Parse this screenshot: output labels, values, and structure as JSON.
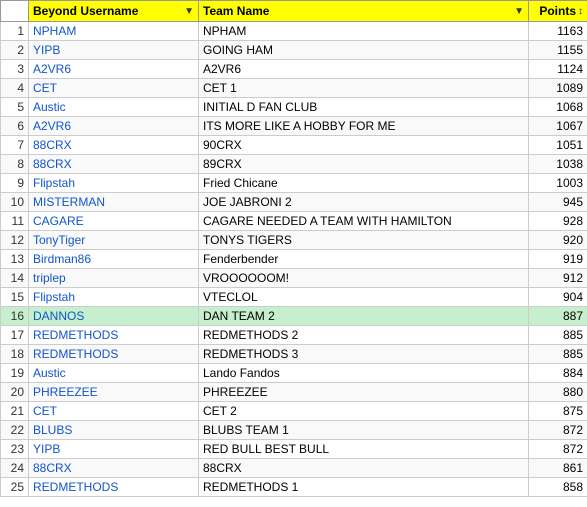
{
  "headers": {
    "num": "",
    "username": "Beyond Username",
    "team": "Team Name",
    "points": "Points"
  },
  "rows": [
    {
      "num": 1,
      "username": "NPHAM",
      "team": "NPHAM",
      "points": 1163
    },
    {
      "num": 2,
      "username": "YIPB",
      "team": "GOING HAM",
      "points": 1155
    },
    {
      "num": 3,
      "username": "A2VR6",
      "team": "A2VR6",
      "points": 1124
    },
    {
      "num": 4,
      "username": "CET",
      "team": "CET 1",
      "points": 1089
    },
    {
      "num": 5,
      "username": "Austic",
      "team": "INITIAL D FAN CLUB",
      "points": 1068
    },
    {
      "num": 6,
      "username": "A2VR6",
      "team": "ITS MORE LIKE A HOBBY FOR ME",
      "points": 1067
    },
    {
      "num": 7,
      "username": "88CRX",
      "team": "90CRX",
      "points": 1051
    },
    {
      "num": 8,
      "username": "88CRX",
      "team": "89CRX",
      "points": 1038
    },
    {
      "num": 9,
      "username": "Flipstah",
      "team": "Fried Chicane",
      "points": 1003
    },
    {
      "num": 10,
      "username": "MISTERMAN",
      "team": "JOE JABRONI 2",
      "points": 945
    },
    {
      "num": 11,
      "username": "CAGARE",
      "team": "CAGARE NEEDED A TEAM WITH HAMILTON",
      "points": 928
    },
    {
      "num": 12,
      "username": "TonyTiger",
      "team": "TONYS TIGERS",
      "points": 920
    },
    {
      "num": 13,
      "username": "Birdman86",
      "team": "Fenderbender",
      "points": 919
    },
    {
      "num": 14,
      "username": "triplep",
      "team": "VROOOOOOM!",
      "points": 912
    },
    {
      "num": 15,
      "username": "Flipstah",
      "team": "VTECLOL",
      "points": 904
    },
    {
      "num": 16,
      "username": "DANNOS",
      "team": "DAN TEAM 2",
      "points": 887,
      "highlight": true
    },
    {
      "num": 17,
      "username": "REDMETHODS",
      "team": "REDMETHODS 2",
      "points": 885
    },
    {
      "num": 18,
      "username": "REDMETHODS",
      "team": "REDMETHODS 3",
      "points": 885
    },
    {
      "num": 19,
      "username": "Austic",
      "team": "Lando Fandos",
      "points": 884
    },
    {
      "num": 20,
      "username": "PHREEZEE",
      "team": "PHREEZEE",
      "points": 880
    },
    {
      "num": 21,
      "username": "CET",
      "team": "CET 2",
      "points": 875
    },
    {
      "num": 22,
      "username": "BLUBS",
      "team": "BLUBS TEAM 1",
      "points": 872
    },
    {
      "num": 23,
      "username": "YIPB",
      "team": "RED BULL BEST BULL",
      "points": 872
    },
    {
      "num": 24,
      "username": "88CRX",
      "team": "88CRX",
      "points": 861
    },
    {
      "num": 25,
      "username": "REDMETHODS",
      "team": "REDMETHODS 1",
      "points": 858
    }
  ]
}
